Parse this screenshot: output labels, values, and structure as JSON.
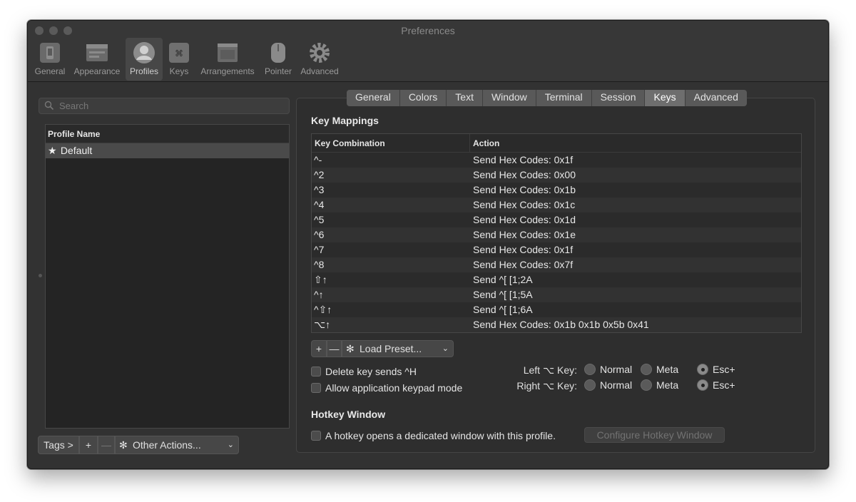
{
  "window": {
    "title": "Preferences"
  },
  "toolbar": {
    "items": [
      {
        "label": "General",
        "icon": "phone-switch-icon"
      },
      {
        "label": "Appearance",
        "icon": "window-icon"
      },
      {
        "label": "Profiles",
        "icon": "user-icon",
        "active": true
      },
      {
        "label": "Keys",
        "icon": "command-key-icon"
      },
      {
        "label": "Arrangements",
        "icon": "arrangements-icon"
      },
      {
        "label": "Pointer",
        "icon": "mouse-icon"
      },
      {
        "label": "Advanced",
        "icon": "gear-icon"
      }
    ]
  },
  "profiles": {
    "search_placeholder": "Search",
    "column_header": "Profile Name",
    "items": [
      {
        "name": "Default",
        "default": true
      }
    ],
    "tags_label": "Tags >",
    "add_label": "+",
    "remove_label": "—",
    "other_actions_label": "Other Actions..."
  },
  "tabs": [
    "General",
    "Colors",
    "Text",
    "Window",
    "Terminal",
    "Session",
    "Keys",
    "Advanced"
  ],
  "active_tab": "Keys",
  "key_mappings": {
    "title": "Key Mappings",
    "headers": [
      "Key Combination",
      "Action"
    ],
    "rows": [
      [
        "^-",
        "Send Hex Codes: 0x1f"
      ],
      [
        "^2",
        "Send Hex Codes: 0x00"
      ],
      [
        "^3",
        "Send Hex Codes: 0x1b"
      ],
      [
        "^4",
        "Send Hex Codes: 0x1c"
      ],
      [
        "^5",
        "Send Hex Codes: 0x1d"
      ],
      [
        "^6",
        "Send Hex Codes: 0x1e"
      ],
      [
        "^7",
        "Send Hex Codes: 0x1f"
      ],
      [
        "^8",
        "Send Hex Codes: 0x7f"
      ],
      [
        "⇧↑",
        "Send ^[ [1;2A"
      ],
      [
        "^↑",
        "Send ^[ [1;5A"
      ],
      [
        "^⇧↑",
        "Send ^[ [1;6A"
      ],
      [
        "⌥↑",
        "Send Hex Codes: 0x1b 0x1b 0x5b 0x41"
      ]
    ],
    "add_label": "+",
    "remove_label": "—",
    "load_preset_label": "Load Preset..."
  },
  "options": {
    "delete_key_label": "Delete key sends ^H",
    "keypad_mode_label": "Allow application keypad mode",
    "left_option_label": "Left ⌥ Key:",
    "right_option_label": "Right ⌥ Key:",
    "radio_labels": [
      "Normal",
      "Meta",
      "Esc+"
    ],
    "left_selected": "Esc+",
    "right_selected": "Esc+"
  },
  "hotkey": {
    "title": "Hotkey Window",
    "checkbox_label": "A hotkey opens a dedicated window with this profile.",
    "configure_label": "Configure Hotkey Window"
  }
}
